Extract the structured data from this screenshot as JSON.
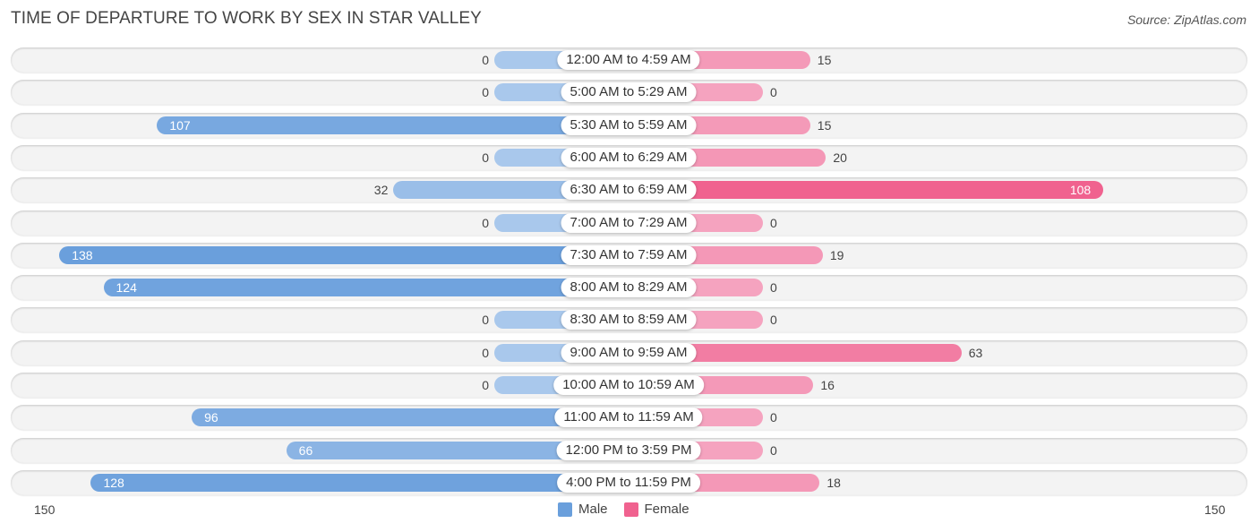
{
  "title": "TIME OF DEPARTURE TO WORK BY SEX IN STAR VALLEY",
  "source": "Source: ZipAtlas.com",
  "colors": {
    "male_strong": "#6a9fdc",
    "male_light": "#a9c8ec",
    "female_strong": "#f0628f",
    "female_light": "#f5a3bf"
  },
  "chart_data": {
    "type": "bar",
    "orientation": "horizontal-diverging",
    "title": "TIME OF DEPARTURE TO WORK BY SEX IN STAR VALLEY",
    "categories": [
      "12:00 AM to 4:59 AM",
      "5:00 AM to 5:29 AM",
      "5:30 AM to 5:59 AM",
      "6:00 AM to 6:29 AM",
      "6:30 AM to 6:59 AM",
      "7:00 AM to 7:29 AM",
      "7:30 AM to 7:59 AM",
      "8:00 AM to 8:29 AM",
      "8:30 AM to 8:59 AM",
      "9:00 AM to 9:59 AM",
      "10:00 AM to 10:59 AM",
      "11:00 AM to 11:59 AM",
      "12:00 PM to 3:59 PM",
      "4:00 PM to 11:59 PM"
    ],
    "series": [
      {
        "name": "Male",
        "values": [
          0,
          0,
          107,
          0,
          32,
          0,
          138,
          124,
          0,
          0,
          0,
          96,
          66,
          128
        ]
      },
      {
        "name": "Female",
        "values": [
          15,
          0,
          15,
          20,
          108,
          0,
          19,
          0,
          0,
          63,
          16,
          0,
          0,
          18
        ]
      }
    ],
    "axis": {
      "left_label": "150",
      "right_label": "150",
      "range": [
        0,
        150
      ]
    },
    "legend": {
      "position": "bottom-center",
      "entries": [
        "Male",
        "Female"
      ]
    },
    "xlabel": "",
    "ylabel": ""
  }
}
